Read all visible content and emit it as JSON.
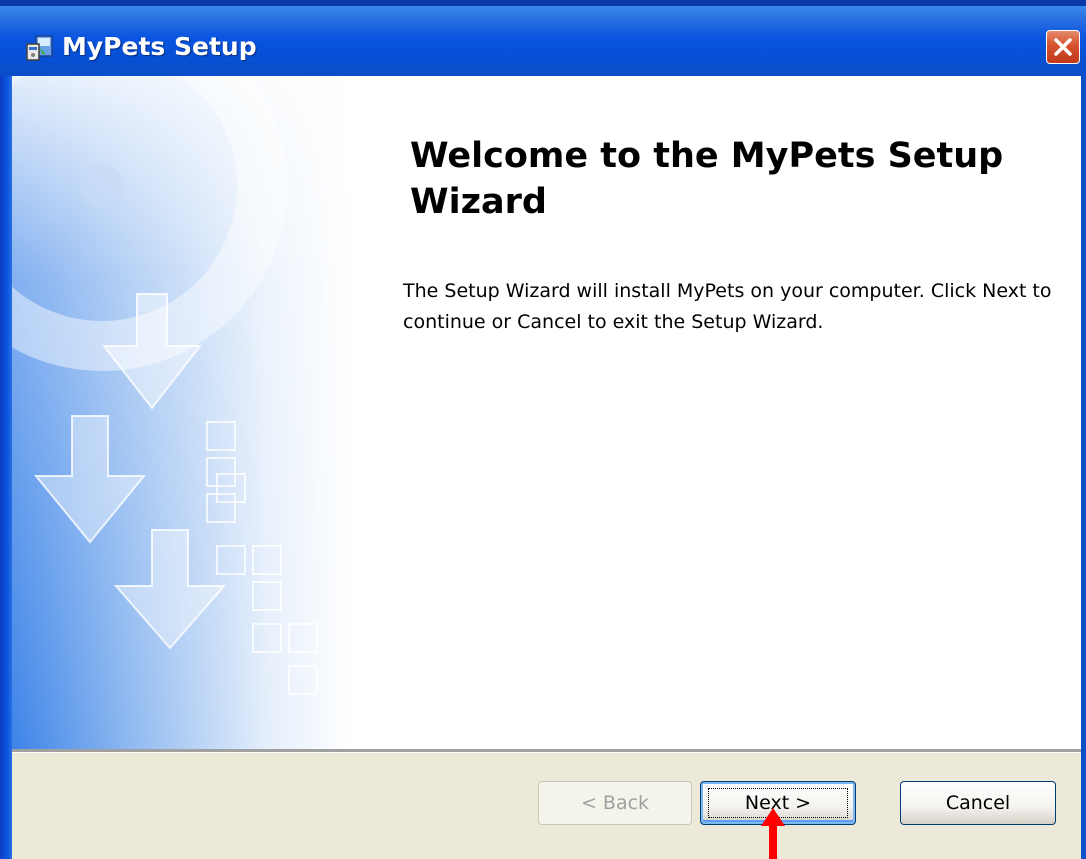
{
  "window": {
    "title": "MyPets Setup",
    "icon": "installer-icon"
  },
  "main": {
    "heading": "Welcome to the MyPets Setup Wizard",
    "description": "The Setup Wizard will install MyPets on your computer.  Click Next to continue or Cancel to exit the Setup Wizard."
  },
  "footer": {
    "back_label": "< Back",
    "next_label": "Next >",
    "cancel_label": "Cancel"
  },
  "colors": {
    "titlebar": "#0a55e0",
    "close_button": "#d6532e",
    "footer_background": "#ece9d8",
    "annotation_arrow": "#ff0000"
  }
}
